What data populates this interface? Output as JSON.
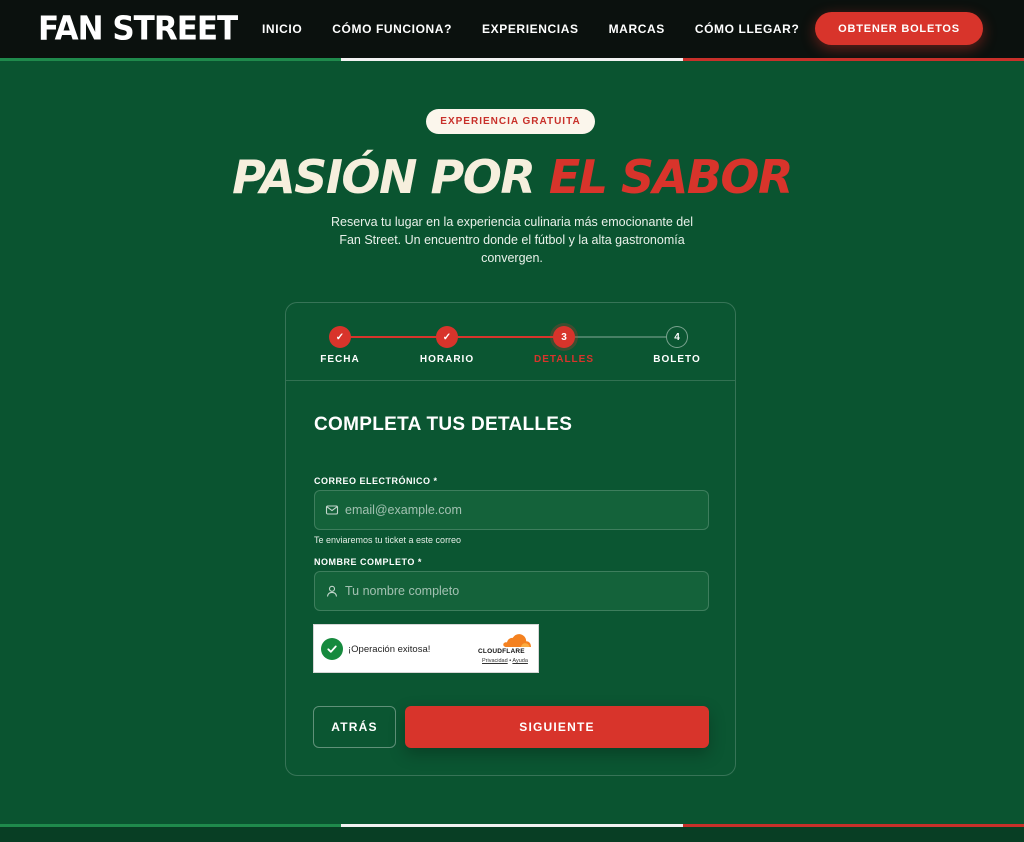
{
  "header": {
    "logo": "FAN STREET",
    "nav": [
      "INICIO",
      "CÓMO FUNCIONA?",
      "EXPERIENCIAS",
      "MARCAS",
      "CÓMO LLEGAR?"
    ],
    "cta_label": "OBTENER BOLETOS"
  },
  "hero": {
    "badge": "EXPERIENCIA GRATUITA",
    "title_part1": "PASIÓN POR",
    "title_part2": "EL SABOR",
    "subtitle": "Reserva tu lugar en la experiencia culinaria más emocionante del Fan Street. Un encuentro donde el fútbol y la alta gastronomía convergen."
  },
  "stepper": {
    "steps": [
      {
        "label": "FECHA",
        "marker": "✓",
        "state": "done"
      },
      {
        "label": "HORARIO",
        "marker": "✓",
        "state": "done"
      },
      {
        "label": "DETALLES",
        "marker": "3",
        "state": "active"
      },
      {
        "label": "BOLETO",
        "marker": "4",
        "state": "todo"
      }
    ]
  },
  "form": {
    "title": "COMPLETA TUS DETALLES",
    "email_label": "CORREO ELECTRÓNICO *",
    "email_placeholder": "email@example.com",
    "email_value": "",
    "email_hint": "Te enviaremos tu ticket a este correo",
    "name_label": "NOMBRE COMPLETO *",
    "name_placeholder": "Tu nombre completo",
    "name_value": "",
    "back_label": "ATRÁS",
    "next_label": "SIGUIENTE"
  },
  "turnstile": {
    "status": "¡Operación exitosa!",
    "brand": "CLOUDFLARE",
    "privacy": "Privacidad",
    "separator": "•",
    "help": "Ayuda"
  },
  "colors": {
    "background": "#0a5430",
    "header": "#0b110e",
    "accent_red": "#d8342b",
    "cream": "#f6efdd",
    "flag_green": "#1f8a4c",
    "flag_white": "#f2f2f2",
    "flag_red": "#c8302a"
  },
  "icons": {
    "email": "mail-icon",
    "name": "user-icon",
    "check": "check-icon",
    "cloud": "cloudflare-cloud-icon"
  }
}
